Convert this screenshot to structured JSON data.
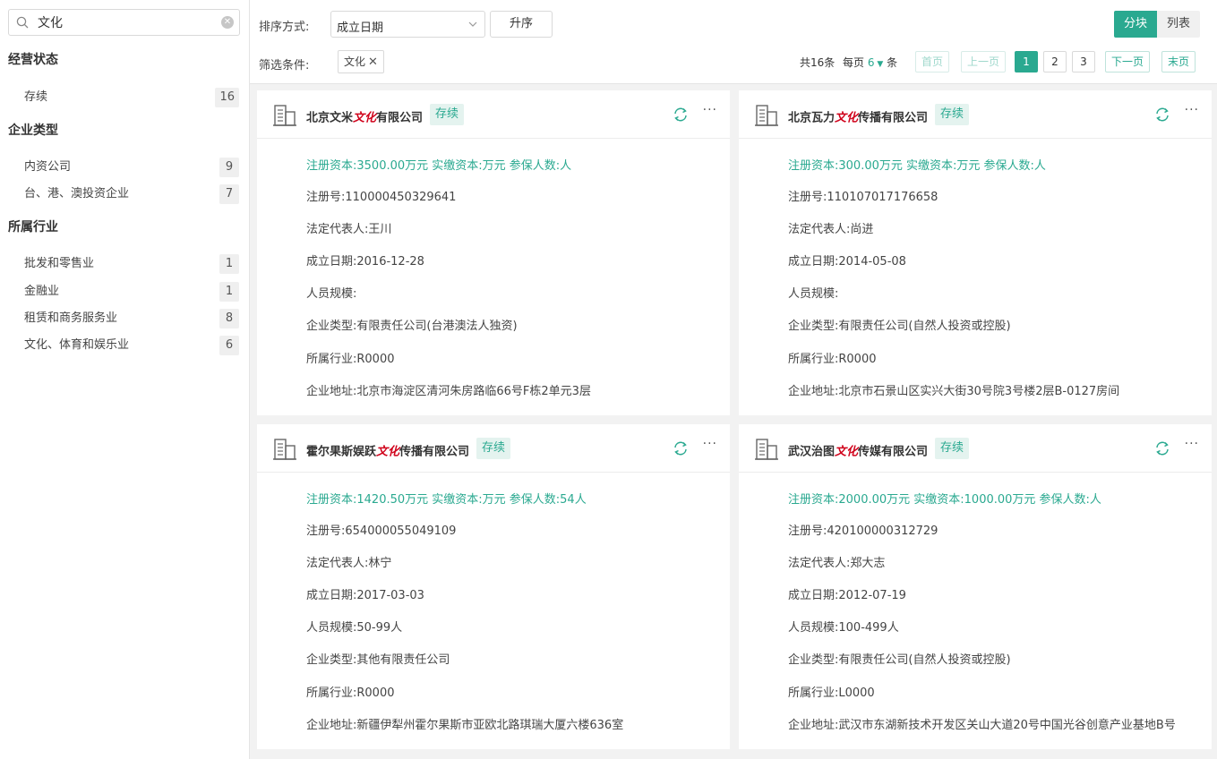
{
  "search": {
    "value": "文化",
    "clear": "✕"
  },
  "filters": [
    {
      "title": "经营状态",
      "items": [
        {
          "label": "存续",
          "count": "16"
        }
      ]
    },
    {
      "title": "企业类型",
      "items": [
        {
          "label": "内资公司",
          "count": "9"
        },
        {
          "label": "台、港、澳投资企业",
          "count": "7"
        }
      ]
    },
    {
      "title": "所属行业",
      "items": [
        {
          "label": "批发和零售业",
          "count": "1"
        },
        {
          "label": "金融业",
          "count": "1"
        },
        {
          "label": "租赁和商务服务业",
          "count": "8"
        },
        {
          "label": "文化、体育和娱乐业",
          "count": "6"
        }
      ]
    }
  ],
  "toolbar": {
    "sort_label": "排序方式:",
    "sort_value": "成立日期",
    "order_button": "升序",
    "filter_label": "筛选条件:",
    "filter_tag": "文化",
    "view_block": "分块",
    "view_list": "列表"
  },
  "pagination": {
    "total_text": "共16条",
    "per_page_prefix": "每页",
    "per_page_value": "6",
    "per_page_suffix": "条",
    "first": "首页",
    "prev": "上一页",
    "pages": [
      "1",
      "2",
      "3"
    ],
    "current": "1",
    "next": "下一页",
    "last": "末页"
  },
  "cards": [
    {
      "name_prefix": "北京文米",
      "name_highlight": "文化",
      "name_suffix": "有限公司",
      "status": "存续",
      "capital_line": "注册资本:3500.00万元   实缴资本:万元   参保人数:人",
      "reg_no": "注册号:110000450329641",
      "legal_rep": "法定代表人:王川",
      "founded": "成立日期:2016-12-28",
      "staff": "人员规模:",
      "type": "企业类型:有限责任公司(台港澳法人独资)",
      "industry": "所属行业:R0000",
      "address": "企业地址:北京市海淀区清河朱房路临66号F栋2单元3层"
    },
    {
      "name_prefix": "北京瓦力",
      "name_highlight": "文化",
      "name_suffix": "传播有限公司",
      "status": "存续",
      "capital_line": "注册资本:300.00万元   实缴资本:万元   参保人数:人",
      "reg_no": "注册号:110107017176658",
      "legal_rep": "法定代表人:尚进",
      "founded": "成立日期:2014-05-08",
      "staff": "人员规模:",
      "type": "企业类型:有限责任公司(自然人投资或控股)",
      "industry": "所属行业:R0000",
      "address": "企业地址:北京市石景山区实兴大街30号院3号楼2层B-0127房间"
    },
    {
      "name_prefix": "霍尔果斯娱跃",
      "name_highlight": "文化",
      "name_suffix": "传播有限公司",
      "status": "存续",
      "capital_line": "注册资本:1420.50万元   实缴资本:万元   参保人数:54人",
      "reg_no": "注册号:654000055049109",
      "legal_rep": "法定代表人:林宁",
      "founded": "成立日期:2017-03-03",
      "staff": "人员规模:50-99人",
      "type": "企业类型:其他有限责任公司",
      "industry": "所属行业:R0000",
      "address": "企业地址:新疆伊犁州霍尔果斯市亚欧北路琪瑞大厦六楼636室"
    },
    {
      "name_prefix": "武汉治图",
      "name_highlight": "文化",
      "name_suffix": "传媒有限公司",
      "status": "存续",
      "capital_line": "注册资本:2000.00万元   实缴资本:1000.00万元   参保人数:人",
      "reg_no": "注册号:420100000312729",
      "legal_rep": "法定代表人:郑大志",
      "founded": "成立日期:2012-07-19",
      "staff": "人员规模:100-499人",
      "type": "企业类型:有限责任公司(自然人投资或控股)",
      "industry": "所属行业:L0000",
      "address": "企业地址:武汉市东湖新技术开发区关山大道20号中国光谷创意产业基地B号"
    }
  ]
}
